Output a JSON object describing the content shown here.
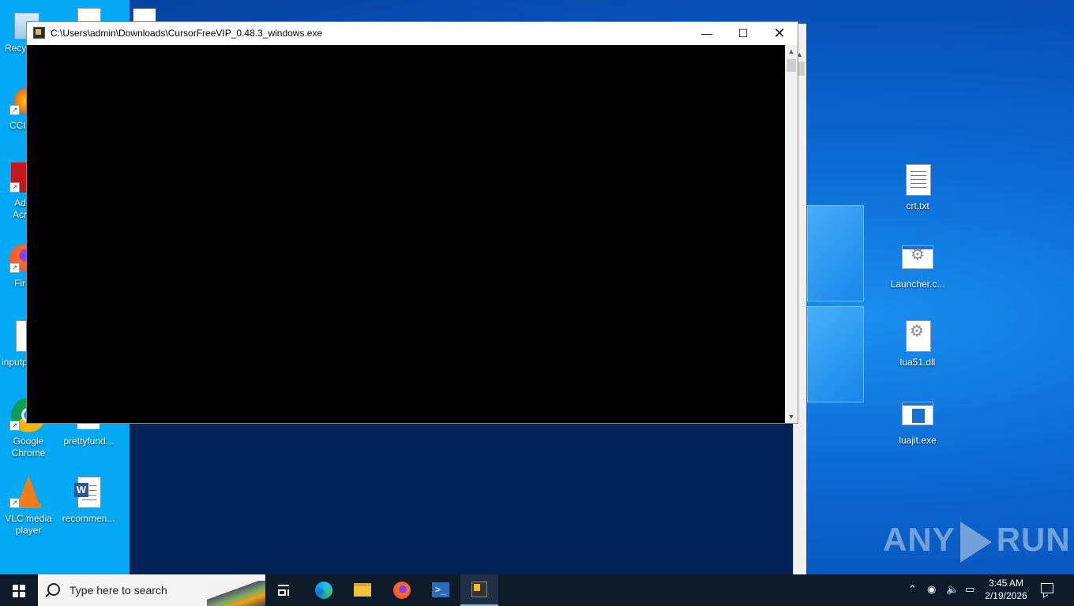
{
  "desktop": {
    "icons": [
      {
        "id": "recycle-bin",
        "label": "Recy"
      },
      {
        "id": "ccleaner",
        "label": "CCl"
      },
      {
        "id": "acrobat",
        "label_line1": "Ad",
        "label_line2": "Acr"
      },
      {
        "id": "firefox",
        "label": "Fir"
      },
      {
        "id": "inputp",
        "label": "inputp"
      },
      {
        "id": "chrome",
        "label_line1": "Google",
        "label_line2": "Chrome"
      },
      {
        "id": "prettyfund",
        "label": "prettyfund..."
      },
      {
        "id": "vlc",
        "label_line1": "VLC media",
        "label_line2": "player"
      },
      {
        "id": "recommen",
        "label": "recommen..."
      },
      {
        "id": "crt",
        "label": "crt.txt"
      },
      {
        "id": "launcher",
        "label": "Launcher.c..."
      },
      {
        "id": "lua51",
        "label": "lua51.dll"
      },
      {
        "id": "luajit",
        "label": "luajit.exe"
      }
    ]
  },
  "console_window": {
    "title": "C:\\Users\\admin\\Downloads\\CursorFreeVIP_0.48.3_windows.exe",
    "minimize_glyph": "—",
    "maximize_glyph": "☐",
    "close_glyph": "✕",
    "background": "#000000"
  },
  "watermark": {
    "left_text": "ANY",
    "right_text": "RUN"
  },
  "taskbar": {
    "search_placeholder": "Type here to search",
    "clock_time": "3:45 AM",
    "clock_date": "2/19/2026",
    "pinned": [
      "task-view",
      "edge",
      "file-explorer",
      "firefox",
      "powershell",
      "console-app"
    ],
    "active_item": "console-app",
    "tray_icons": [
      "chevron-up-icon",
      "webcam-icon",
      "volume-icon",
      "network-icon"
    ]
  },
  "colors": {
    "taskbar": "#0d1b2a",
    "desktop_strip": "#03a9f4",
    "accent": "#76b9ed"
  }
}
